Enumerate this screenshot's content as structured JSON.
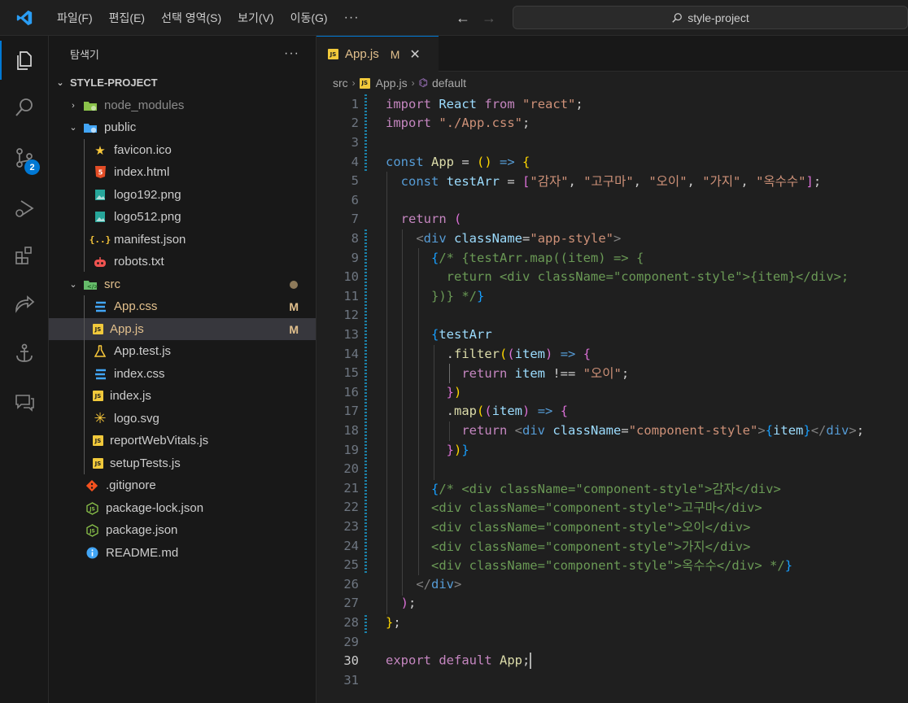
{
  "menu": {
    "items": [
      "파일(F)",
      "편집(E)",
      "선택 영역(S)",
      "보기(V)",
      "이동(G)"
    ],
    "more": "···"
  },
  "search": {
    "text": "style-project"
  },
  "activity": {
    "scm_badge": "2"
  },
  "explorer": {
    "title": "탐색기",
    "more": "···",
    "project": "STYLE-PROJECT",
    "items": [
      {
        "label": "node_modules",
        "kind": "folder",
        "icon": "node-folder-icon"
      },
      {
        "label": "public",
        "kind": "folder-open",
        "icon": "public-folder-icon"
      },
      {
        "label": "favicon.ico",
        "icon": "star-icon"
      },
      {
        "label": "index.html",
        "icon": "html5-icon"
      },
      {
        "label": "logo192.png",
        "icon": "image-icon"
      },
      {
        "label": "logo512.png",
        "icon": "image-icon"
      },
      {
        "label": "manifest.json",
        "icon": "json-icon"
      },
      {
        "label": "robots.txt",
        "icon": "robot-icon"
      },
      {
        "label": "src",
        "kind": "folder-open",
        "icon": "src-folder-icon"
      },
      {
        "label": "App.css",
        "status": "M",
        "icon": "css-icon"
      },
      {
        "label": "App.js",
        "status": "M",
        "icon": "js-icon",
        "selected": true
      },
      {
        "label": "App.test.js",
        "icon": "flask-icon"
      },
      {
        "label": "index.css",
        "icon": "css-icon"
      },
      {
        "label": "index.js",
        "icon": "js-icon"
      },
      {
        "label": "logo.svg",
        "icon": "svg-icon"
      },
      {
        "label": "reportWebVitals.js",
        "icon": "js-icon"
      },
      {
        "label": "setupTests.js",
        "icon": "js-icon"
      },
      {
        "label": ".gitignore",
        "icon": "git-icon"
      },
      {
        "label": "package-lock.json",
        "icon": "npm-icon"
      },
      {
        "label": "package.json",
        "icon": "npm-icon"
      },
      {
        "label": "README.md",
        "icon": "info-icon"
      }
    ]
  },
  "tab": {
    "name": "App.js",
    "status": "M",
    "close": "✕",
    "js": "JS"
  },
  "breadcrumb": {
    "root": "src",
    "file": "App.js",
    "symbol": "default"
  },
  "editor": {
    "current_line": 30,
    "lines": [
      [
        [
          "kc",
          "import"
        ],
        [
          "pl",
          " "
        ],
        [
          "id",
          "React"
        ],
        [
          "pl",
          " "
        ],
        [
          "kc",
          "from"
        ],
        [
          "pl",
          " "
        ],
        [
          "str",
          "\"react\""
        ],
        [
          "pl",
          ";"
        ]
      ],
      [
        [
          "kc",
          "import"
        ],
        [
          "pl",
          " "
        ],
        [
          "str",
          "\"./App.css\""
        ],
        [
          "pl",
          ";"
        ]
      ],
      [],
      [
        [
          "kw",
          "const"
        ],
        [
          "pl",
          " "
        ],
        [
          "fn",
          "App"
        ],
        [
          "pl",
          " = "
        ],
        [
          "p1",
          "()"
        ],
        [
          "pl",
          " "
        ],
        [
          "kw",
          "=>"
        ],
        [
          "pl",
          " "
        ],
        [
          "p1",
          "{"
        ]
      ],
      [
        [
          "pl",
          "  "
        ],
        [
          "kw",
          "const"
        ],
        [
          "pl",
          " "
        ],
        [
          "id",
          "testArr"
        ],
        [
          "pl",
          " = "
        ],
        [
          "p2",
          "["
        ],
        [
          "str",
          "\"감자\""
        ],
        [
          "pl",
          ", "
        ],
        [
          "str",
          "\"고구마\""
        ],
        [
          "pl",
          ", "
        ],
        [
          "str",
          "\"오이\""
        ],
        [
          "pl",
          ", "
        ],
        [
          "str",
          "\"가지\""
        ],
        [
          "pl",
          ", "
        ],
        [
          "str",
          "\"옥수수\""
        ],
        [
          "p2",
          "]"
        ],
        [
          "pl",
          ";"
        ]
      ],
      [],
      [
        [
          "pl",
          "  "
        ],
        [
          "kc",
          "return"
        ],
        [
          "pl",
          " "
        ],
        [
          "p2",
          "("
        ]
      ],
      [
        [
          "pl",
          "    "
        ],
        [
          "tagb",
          "<"
        ],
        [
          "tag",
          "div"
        ],
        [
          "pl",
          " "
        ],
        [
          "attr",
          "className"
        ],
        [
          "pl",
          "="
        ],
        [
          "str",
          "\"app-style\""
        ],
        [
          "tagb",
          ">"
        ]
      ],
      [
        [
          "pl",
          "      "
        ],
        [
          "p3",
          "{"
        ],
        [
          "com",
          "/* {testArr.map((item) => {"
        ]
      ],
      [
        [
          "com",
          "        return <div className=\"component-style\">{item}</div>;"
        ]
      ],
      [
        [
          "com",
          "      })} */"
        ],
        [
          "p3",
          "}"
        ]
      ],
      [],
      [
        [
          "pl",
          "      "
        ],
        [
          "p3",
          "{"
        ],
        [
          "id",
          "testArr"
        ]
      ],
      [
        [
          "pl",
          "        ."
        ],
        [
          "fn",
          "filter"
        ],
        [
          "p1",
          "("
        ],
        [
          "p2",
          "("
        ],
        [
          "id",
          "item"
        ],
        [
          "p2",
          ")"
        ],
        [
          "pl",
          " "
        ],
        [
          "kw",
          "=>"
        ],
        [
          "pl",
          " "
        ],
        [
          "p2",
          "{"
        ]
      ],
      [
        [
          "pl",
          "          "
        ],
        [
          "kc",
          "return"
        ],
        [
          "pl",
          " "
        ],
        [
          "id",
          "item"
        ],
        [
          "pl",
          " !== "
        ],
        [
          "str",
          "\"오이\""
        ],
        [
          "pl",
          ";"
        ]
      ],
      [
        [
          "pl",
          "        "
        ],
        [
          "p2",
          "}"
        ],
        [
          "p1",
          ")"
        ]
      ],
      [
        [
          "pl",
          "        ."
        ],
        [
          "fn",
          "map"
        ],
        [
          "p1",
          "("
        ],
        [
          "p2",
          "("
        ],
        [
          "id",
          "item"
        ],
        [
          "p2",
          ")"
        ],
        [
          "pl",
          " "
        ],
        [
          "kw",
          "=>"
        ],
        [
          "pl",
          " "
        ],
        [
          "p2",
          "{"
        ]
      ],
      [
        [
          "pl",
          "          "
        ],
        [
          "kc",
          "return"
        ],
        [
          "pl",
          " "
        ],
        [
          "tagb",
          "<"
        ],
        [
          "tag",
          "div"
        ],
        [
          "pl",
          " "
        ],
        [
          "attr",
          "className"
        ],
        [
          "pl",
          "="
        ],
        [
          "str",
          "\"component-style\""
        ],
        [
          "tagb",
          ">"
        ],
        [
          "p3",
          "{"
        ],
        [
          "id",
          "item"
        ],
        [
          "p3",
          "}"
        ],
        [
          "tagb",
          "</"
        ],
        [
          "tag",
          "div"
        ],
        [
          "tagb",
          ">"
        ],
        [
          "pl",
          ";"
        ]
      ],
      [
        [
          "pl",
          "        "
        ],
        [
          "p2",
          "}"
        ],
        [
          "p1",
          ")"
        ],
        [
          "p3",
          "}"
        ]
      ],
      [],
      [
        [
          "pl",
          "      "
        ],
        [
          "p3",
          "{"
        ],
        [
          "com",
          "/* <div className=\"component-style\">감자</div>"
        ]
      ],
      [
        [
          "com",
          "      <div className=\"component-style\">고구마</div>"
        ]
      ],
      [
        [
          "com",
          "      <div className=\"component-style\">오이</div>"
        ]
      ],
      [
        [
          "com",
          "      <div className=\"component-style\">가지</div>"
        ]
      ],
      [
        [
          "com",
          "      <div className=\"component-style\">옥수수</div> */"
        ],
        [
          "p3",
          "}"
        ]
      ],
      [
        [
          "pl",
          "    "
        ],
        [
          "tagb",
          "</"
        ],
        [
          "tag",
          "div"
        ],
        [
          "tagb",
          ">"
        ]
      ],
      [
        [
          "pl",
          "  "
        ],
        [
          "p2",
          ")"
        ],
        [
          "pl",
          ";"
        ]
      ],
      [
        [
          "p1",
          "}"
        ],
        [
          "pl",
          ";"
        ]
      ],
      [],
      [
        [
          "kc",
          "export"
        ],
        [
          "pl",
          " "
        ],
        [
          "kc",
          "default"
        ],
        [
          "pl",
          " "
        ],
        [
          "fn",
          "App"
        ],
        [
          "pl",
          ";"
        ]
      ],
      []
    ]
  }
}
